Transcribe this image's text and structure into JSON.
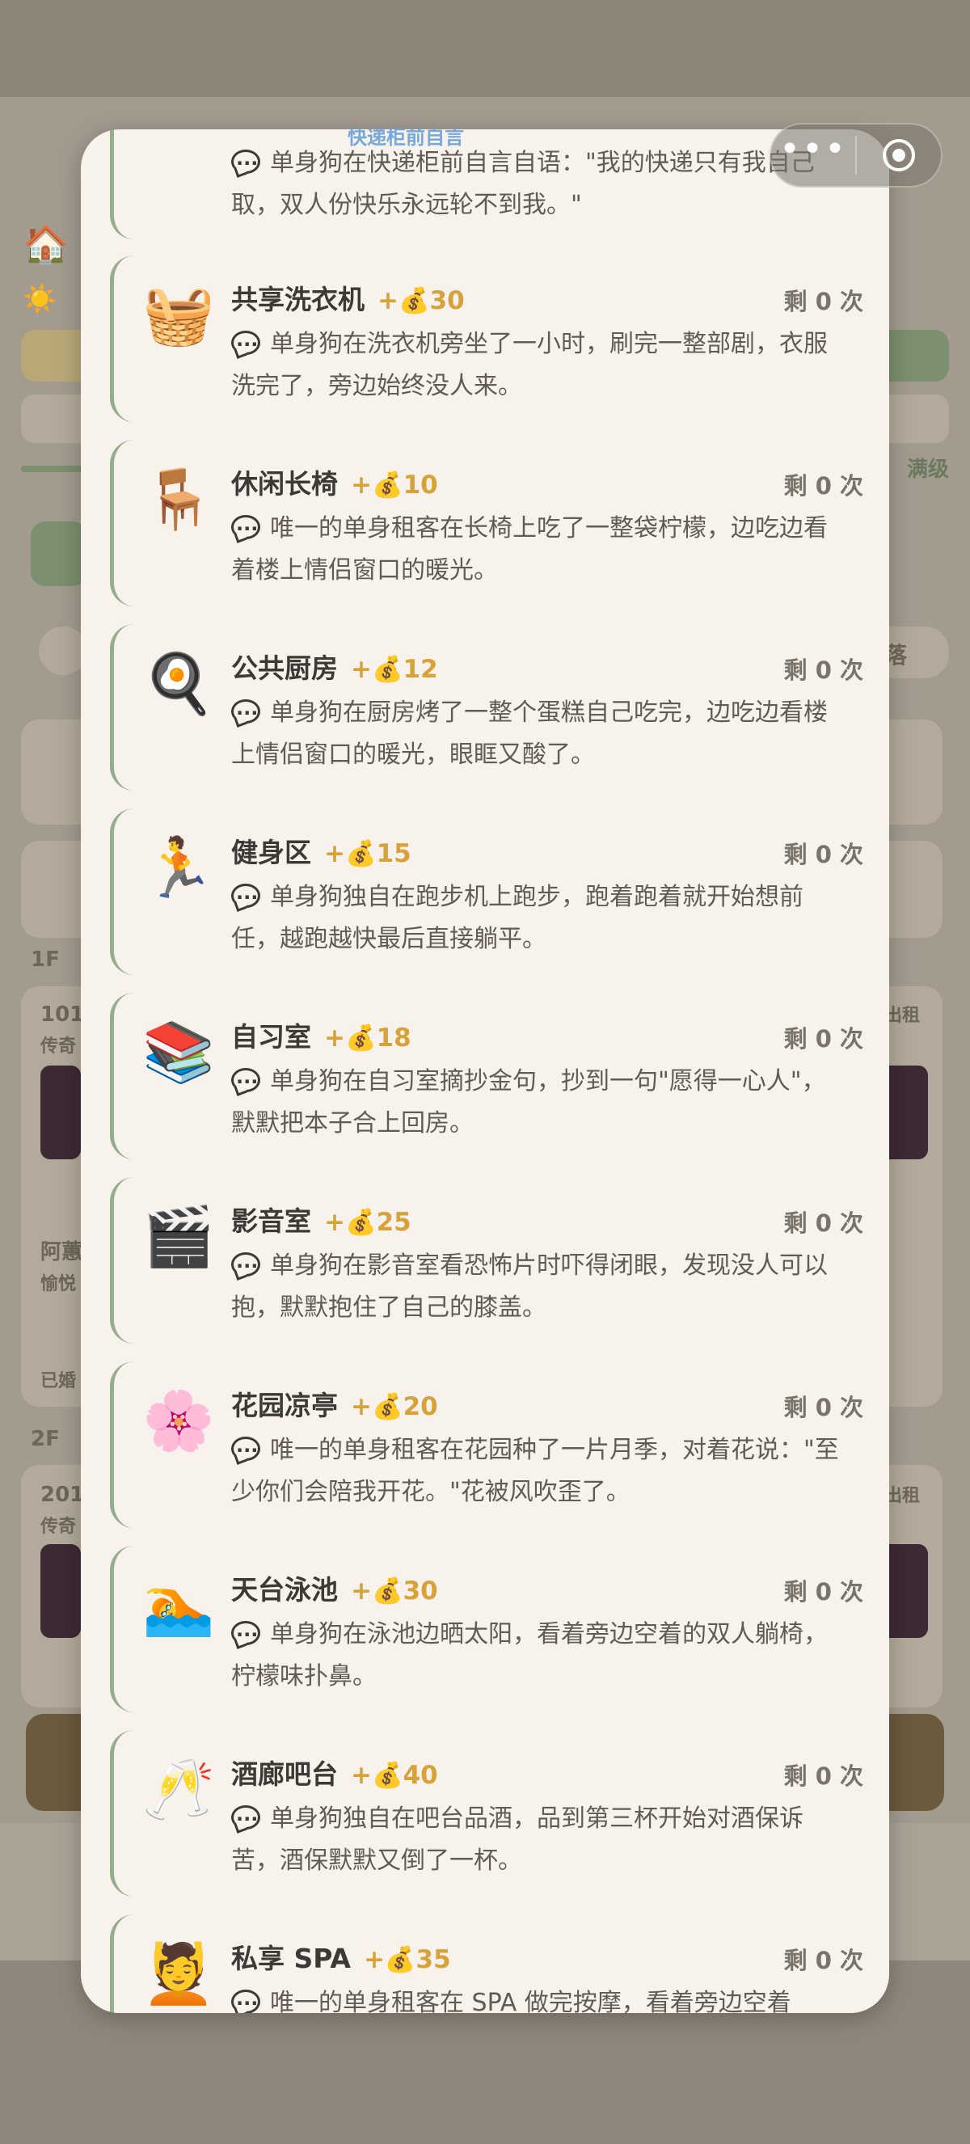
{
  "background": {
    "full_level_label": "满级",
    "tribe_label": "群落",
    "floor_1": "1F",
    "floor_2": "2F",
    "room_101": "101",
    "room_201": "201",
    "legend_1": "传奇",
    "legend_2": "传奇",
    "tenant_name": "阿蕙",
    "tenant_mood": "愉悦",
    "married": "已婚",
    "rent_tag_1": "出租",
    "rent_tag_2": "出租"
  },
  "overlay_label": "快递柜前自言",
  "capsule": {
    "menu_icon": "more-dots-icon",
    "close_icon": "target-icon"
  },
  "items": [
    {
      "icon": "📦",
      "name": "",
      "reward": "",
      "remain": "",
      "desc": "单身狗在快递柜前自言自语：\"我的快递只有我自己取，双人份快乐永远轮不到我。\""
    },
    {
      "icon": "🧺",
      "name": "共享洗衣机",
      "reward": "+💰30",
      "remain": "剩 0 次",
      "desc": "单身狗在洗衣机旁坐了一小时，刷完一整部剧，衣服洗完了，旁边始终没人来。"
    },
    {
      "icon": "🪑",
      "name": "休闲长椅",
      "reward": "+💰10",
      "remain": "剩 0 次",
      "desc": "唯一的单身租客在长椅上吃了一整袋柠檬，边吃边看着楼上情侣窗口的暖光。"
    },
    {
      "icon": "🍳",
      "name": "公共厨房",
      "reward": "+💰12",
      "remain": "剩 0 次",
      "desc": "单身狗在厨房烤了一整个蛋糕自己吃完，边吃边看楼上情侣窗口的暖光，眼眶又酸了。"
    },
    {
      "icon": "🏃",
      "name": "健身区",
      "reward": "+💰15",
      "remain": "剩 0 次",
      "desc": "单身狗独自在跑步机上跑步，跑着跑着就开始想前任，越跑越快最后直接躺平。"
    },
    {
      "icon": "📚",
      "name": "自习室",
      "reward": "+💰18",
      "remain": "剩 0 次",
      "desc": "单身狗在自习室摘抄金句，抄到一句\"愿得一心人\"，默默把本子合上回房。"
    },
    {
      "icon": "🎬",
      "name": "影音室",
      "reward": "+💰25",
      "remain": "剩 0 次",
      "desc": "单身狗在影音室看恐怖片时吓得闭眼，发现没人可以抱，默默抱住了自己的膝盖。"
    },
    {
      "icon": "🌸",
      "name": "花园凉亭",
      "reward": "+💰20",
      "remain": "剩 0 次",
      "desc": "唯一的单身租客在花园种了一片月季，对着花说：\"至少你们会陪我开花。\"花被风吹歪了。"
    },
    {
      "icon": "🏊",
      "name": "天台泳池",
      "reward": "+💰30",
      "remain": "剩 0 次",
      "desc": "单身狗在泳池边晒太阳，看着旁边空着的双人躺椅，柠檬味扑鼻。"
    },
    {
      "icon": "🥂",
      "name": "酒廊吧台",
      "reward": "+💰40",
      "remain": "剩 0 次",
      "desc": "单身狗独自在吧台品酒，品到第三杯开始对酒保诉苦，酒保默默又倒了一杯。"
    },
    {
      "icon": "💆",
      "name": "私享 SPA",
      "reward": "+💰35",
      "remain": "剩 0 次",
      "desc": "唯一的单身租客在 SPA 做完按摩，看着旁边空着"
    }
  ]
}
